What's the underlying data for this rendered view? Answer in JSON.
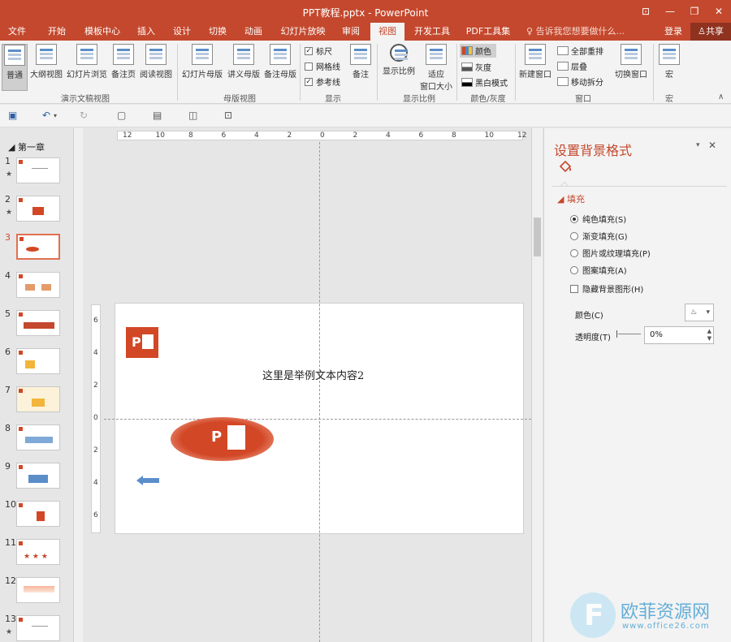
{
  "window": {
    "title": "PPT教程.pptx - PowerPoint",
    "controls": [
      "⊡",
      "—",
      "❐",
      "✕"
    ]
  },
  "tabs": [
    {
      "label": "文件"
    },
    {
      "label": "开始"
    },
    {
      "label": "模板中心"
    },
    {
      "label": "插入"
    },
    {
      "label": "设计"
    },
    {
      "label": "切换"
    },
    {
      "label": "动画"
    },
    {
      "label": "幻灯片放映"
    },
    {
      "label": "审阅"
    },
    {
      "label": "视图",
      "active": true
    },
    {
      "label": "开发工具"
    },
    {
      "label": "PDF工具集"
    }
  ],
  "tellme": "告诉我您想要做什么...",
  "login": "登录",
  "share": "共享",
  "ribbon": {
    "presentation_views": {
      "group_label": "演示文稿视图",
      "buttons": [
        "普通",
        "大纲视图",
        "幻灯片浏览",
        "备注页",
        "阅读视图"
      ]
    },
    "master_views": {
      "group_label": "母版视图",
      "buttons": [
        "幻灯片母版",
        "讲义母版",
        "备注母版"
      ]
    },
    "show": {
      "group_label": "显示",
      "checks": [
        {
          "label": "标尺",
          "checked": true
        },
        {
          "label": "网格线",
          "checked": false
        },
        {
          "label": "参考线",
          "checked": true
        }
      ],
      "notes": "备注"
    },
    "zoom": {
      "group_label": "显示比例",
      "zoom_btn": "显示比例",
      "fit_btn_l1": "适应",
      "fit_btn_l2": "窗口大小"
    },
    "color": {
      "group_label": "颜色/灰度",
      "items": [
        "颜色",
        "灰度",
        "黑白模式"
      ]
    },
    "window": {
      "group_label": "窗口",
      "new_window": "新建窗口",
      "items": [
        "全部重排",
        "层叠",
        "移动拆分"
      ],
      "switch": "切换窗口"
    },
    "macro": {
      "group_label": "宏",
      "btn": "宏"
    }
  },
  "slides_pane": {
    "section": "第一章",
    "slides": [
      {
        "num": "1",
        "star": true
      },
      {
        "num": "2",
        "star": true
      },
      {
        "num": "3",
        "active": true
      },
      {
        "num": "4"
      },
      {
        "num": "5"
      },
      {
        "num": "6"
      },
      {
        "num": "7"
      },
      {
        "num": "8"
      },
      {
        "num": "9"
      },
      {
        "num": "10"
      },
      {
        "num": "11"
      },
      {
        "num": "12"
      },
      {
        "num": "13",
        "star": true
      }
    ]
  },
  "ruler": {
    "h_labels": [
      "12",
      "10",
      "8",
      "6",
      "4",
      "2",
      "0",
      "2",
      "4",
      "6",
      "8",
      "10",
      "12"
    ],
    "v_labels": [
      "6",
      "4",
      "2",
      "0",
      "2",
      "4",
      "6"
    ]
  },
  "slide": {
    "text": "这里是举例文本内容2"
  },
  "format_pane": {
    "title": "设置背景格式",
    "fill_header": "填充",
    "options": [
      {
        "label": "纯色填充(S)",
        "selected": true
      },
      {
        "label": "渐变填充(G)",
        "selected": false
      },
      {
        "label": "图片或纹理填充(P)",
        "selected": false
      },
      {
        "label": "图案填充(A)",
        "selected": false
      }
    ],
    "hide_bg": "隐藏背景图形(H)",
    "color_label": "颜色(C)",
    "transparency_label": "透明度(T)",
    "transparency_value": "0%"
  },
  "watermark": {
    "name": "欧菲资源网",
    "url": "www.office26.com"
  },
  "colors": {
    "accent": "#c4482d",
    "ppt": "#d24726"
  }
}
